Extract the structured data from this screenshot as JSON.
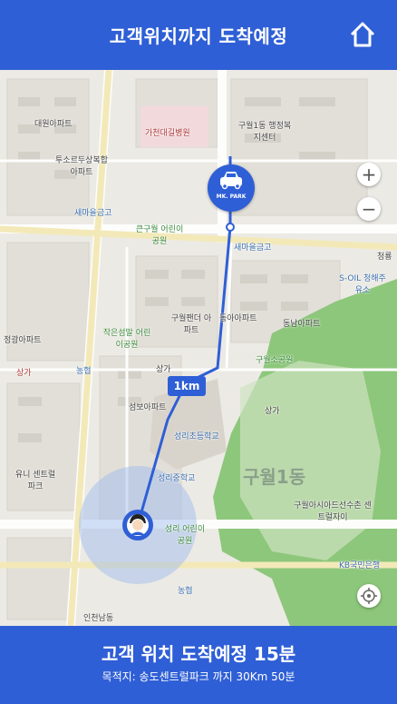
{
  "header": {
    "title": "고객위치까지 도착예정"
  },
  "map": {
    "distance_label": "1km",
    "car_marker_label": "MK. PARK",
    "zoom_in": "+",
    "zoom_out": "−",
    "pois": [
      {
        "text": "대원아파트",
        "style": ""
      },
      {
        "text": "가천대길병원",
        "style": "red"
      },
      {
        "text": "구월1동 행정복지센터",
        "style": ""
      },
      {
        "text": "투소르두상복합 아파트",
        "style": ""
      },
      {
        "text": "새마을금고",
        "style": "blue"
      },
      {
        "text": "큰구월 어린이공원",
        "style": "green"
      },
      {
        "text": "새마을금고",
        "style": "blue"
      },
      {
        "text": "S-OIL 청해주유소",
        "style": "blue"
      },
      {
        "text": "구월팬더 아파트",
        "style": ""
      },
      {
        "text": "동아아파트",
        "style": ""
      },
      {
        "text": "동남아파트",
        "style": ""
      },
      {
        "text": "작은섬말 어린이공원",
        "style": "green"
      },
      {
        "text": "농협",
        "style": "blue"
      },
      {
        "text": "상가",
        "style": ""
      },
      {
        "text": "구월소공원",
        "style": "green"
      },
      {
        "text": "섬보아파트",
        "style": ""
      },
      {
        "text": "상가",
        "style": ""
      },
      {
        "text": "성리초등학교",
        "style": "blue"
      },
      {
        "text": "성리중학교",
        "style": "blue"
      },
      {
        "text": "구월1동",
        "style": "big"
      },
      {
        "text": "유니 센트럴파크",
        "style": ""
      },
      {
        "text": "구월아시아드선수촌 센트럴자이",
        "style": ""
      },
      {
        "text": "성리 어린이공원",
        "style": "green"
      },
      {
        "text": "KB국민은행",
        "style": "blue"
      },
      {
        "text": "농협",
        "style": "blue"
      },
      {
        "text": "인천남동",
        "style": ""
      },
      {
        "text": "정광아파트",
        "style": ""
      },
      {
        "text": "상가",
        "style": "red"
      },
      {
        "text": "청룡",
        "style": ""
      }
    ]
  },
  "footer": {
    "eta": "고객 위치 도착예정 15분",
    "destination": "목적지: 송도센트럴파크 까지 30Km 50분"
  },
  "colors": {
    "brand": "#2f5fd6",
    "route": "#2f5fd6",
    "park": "#8dc77b"
  },
  "icons": {
    "home": "home-icon",
    "car": "car-icon",
    "user": "user-avatar-icon",
    "locate": "locate-icon"
  }
}
